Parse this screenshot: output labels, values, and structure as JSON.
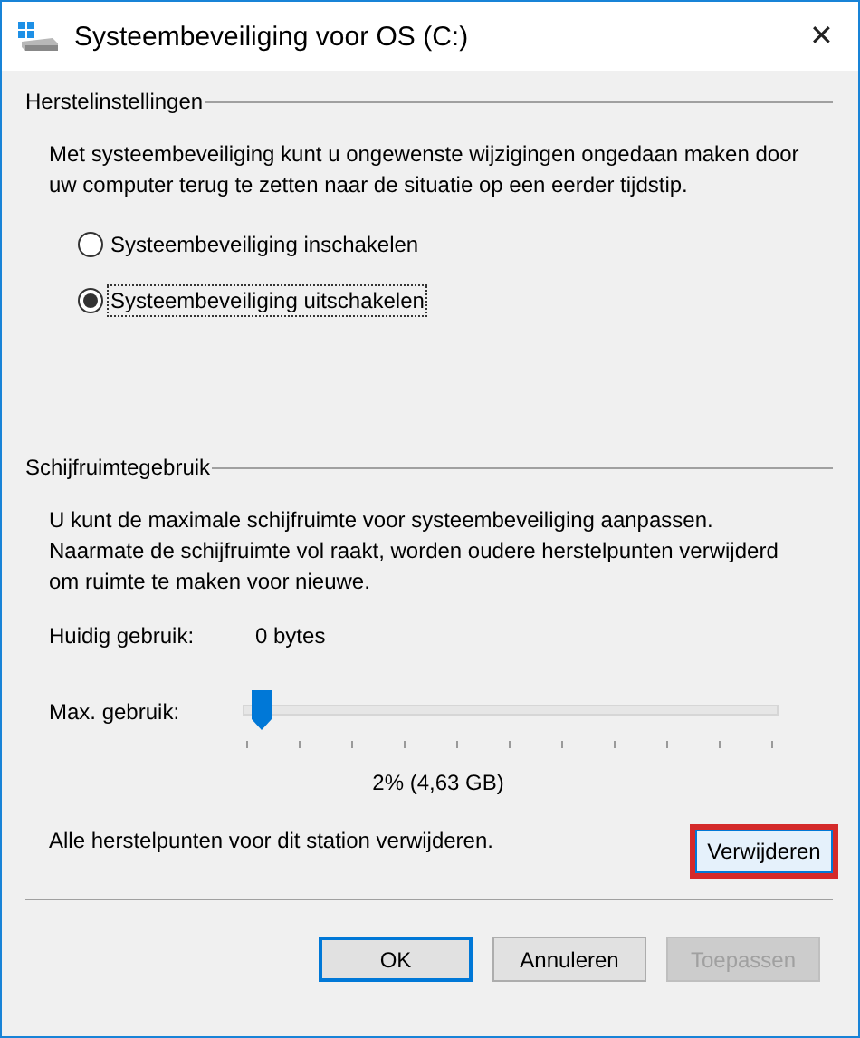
{
  "window": {
    "title": "Systeembeveiliging voor OS (C:)",
    "close": "✕"
  },
  "restore": {
    "heading": "Herstelinstellingen",
    "description": "Met systeembeveiliging kunt u ongewenste wijzigingen ongedaan maken door uw computer terug te zetten naar de situatie op een eerder tijdstip.",
    "options": [
      {
        "label": "Systeembeveiliging inschakelen",
        "selected": false
      },
      {
        "label": "Systeembeveiliging uitschakelen",
        "selected": true
      }
    ]
  },
  "disk": {
    "heading": "Schijfruimtegebruik",
    "description": "U kunt de maximale schijfruimte voor systeembeveiliging aanpassen. Naarmate de schijfruimte vol raakt, worden oudere herstelpunten verwijderd om ruimte te maken voor nieuwe.",
    "current_label": "Huidig gebruik:",
    "current_value": "0 bytes",
    "max_label": "Max. gebruik:",
    "max_slider": {
      "level": 0.02
    },
    "max_reading": "2% (4,63 GB)",
    "delete_text": "Alle herstelpunten voor dit station verwijderen.",
    "delete_button": {
      "label": "Verwijderen",
      "highlighted": true
    }
  },
  "buttons": [
    {
      "label": "OK",
      "kind": "default"
    },
    {
      "label": "Annuleren",
      "kind": "normal"
    },
    {
      "label": "Toepassen",
      "kind": "disabled"
    }
  ]
}
